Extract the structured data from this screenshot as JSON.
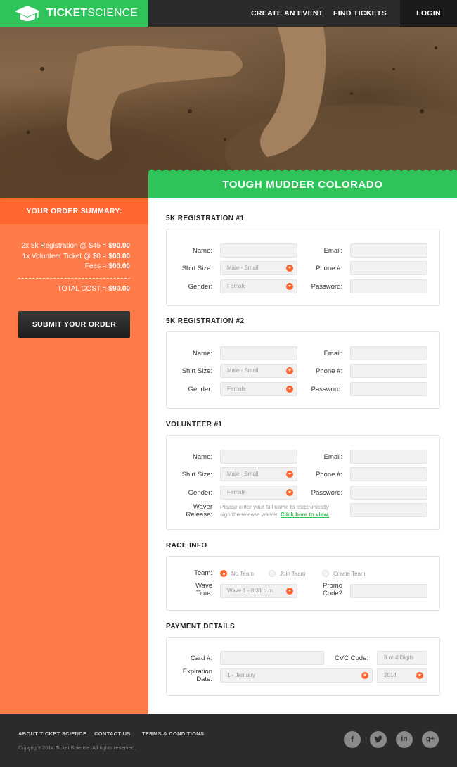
{
  "header": {
    "brand_main": "TICKET",
    "brand_light": "SCIENCE",
    "nav": {
      "create_event": "CREATE AN EVENT",
      "find_tickets": "FIND TICKETS",
      "login": "LOGIN"
    }
  },
  "event_title": "TOUGH MUDDER COLORADO",
  "order_summary": {
    "heading": "YOUR ORDER SUMMARY:",
    "lines": [
      {
        "text": "2x 5k Registration @ $45 = ",
        "amount": "$90.00"
      },
      {
        "text": "1x Volunteer Ticket @ $0 = ",
        "amount": "$00.00"
      },
      {
        "text": "Fees = ",
        "amount": "$00.00"
      }
    ],
    "total_label": "TOTAL COST = ",
    "total_amount": "$90.00",
    "submit": "SUBMIT YOUR ORDER"
  },
  "registrations": [
    {
      "title": "5K REGISTRATION #1",
      "labels": {
        "name": "Name:",
        "email": "Email:",
        "shirt": "Shirt Size:",
        "phone": "Phone #:",
        "gender": "Gender:",
        "password": "Password:"
      },
      "shirt_value": "Male - Small",
      "gender_value": "Female"
    },
    {
      "title": "5K REGISTRATION #2",
      "labels": {
        "name": "Name:",
        "email": "Email:",
        "shirt": "Shirt Size:",
        "phone": "Phone #:",
        "gender": "Gender:",
        "password": "Password:"
      },
      "shirt_value": "Male - Small",
      "gender_value": "Female"
    },
    {
      "title": "VOLUNTEER #1",
      "labels": {
        "name": "Name:",
        "email": "Email:",
        "shirt": "Shirt Size:",
        "phone": "Phone #:",
        "gender": "Gender:",
        "password": "Password:"
      },
      "shirt_value": "Male - Small",
      "gender_value": "Female",
      "waiver_label_1": "Waver",
      "waiver_label_2": "Release:",
      "waiver_text_1": "Please enter your full name to electronically",
      "waiver_text_2": "sign the release waiver. ",
      "waiver_link": "Click here to view."
    }
  ],
  "race_info": {
    "title": "RACE INFO",
    "team_label": "Team:",
    "options": [
      "No Team",
      "Join Team",
      "Create Team"
    ],
    "selected": "No Team",
    "wave_label_1": "Wave",
    "wave_label_2": "Time:",
    "wave_value": "Wave 1 - 8:31 p.m.",
    "promo_label_1": "Promo",
    "promo_label_2": "Code?"
  },
  "payment": {
    "title": "PAYMENT DETAILS",
    "card_label": "Card #:",
    "cvc_label": "CVC Code:",
    "cvc_placeholder": "3 or 4 Digits",
    "exp_label_1": "Expiration",
    "exp_label_2": "Date:",
    "month_value": "1 - January",
    "year_value": "2014"
  },
  "footer": {
    "links": [
      "ABOUT TICKET SCIENCE",
      "CONTACT US",
      "TERMS & CONDITIONS"
    ],
    "copyright": "Copyright 2014 Ticket Science. All rights reserved.",
    "social": [
      "facebook-icon",
      "twitter-icon",
      "linkedin-icon",
      "google-plus-icon"
    ]
  },
  "colors": {
    "green": "#2ec45a",
    "orange": "#ff7a49",
    "orange_dark": "#ff6630",
    "dark": "#2b2b2b"
  }
}
